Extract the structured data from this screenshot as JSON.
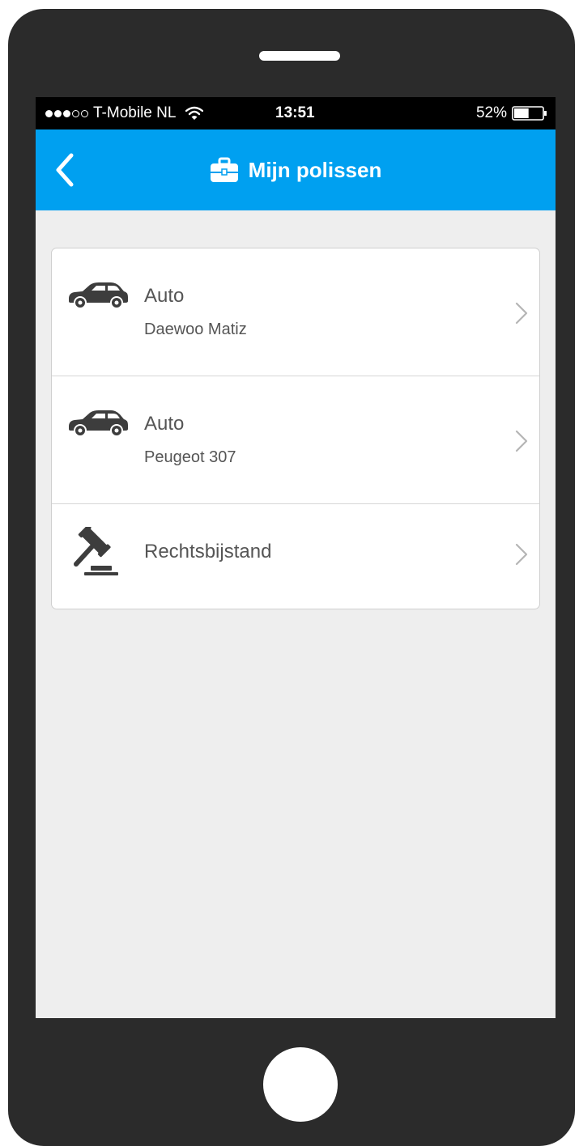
{
  "status_bar": {
    "signal_dots_filled": 3,
    "signal_dots_total": 5,
    "carrier": "T-Mobile NL",
    "time": "13:51",
    "battery_percent": "52%",
    "battery_level": 0.52
  },
  "header": {
    "back_icon": "chevron-left-icon",
    "title_icon": "briefcase-icon",
    "title": "Mijn polissen"
  },
  "policies": [
    {
      "icon": "car-icon",
      "label": "Auto",
      "sublabel": "Daewoo Matiz"
    },
    {
      "icon": "car-icon",
      "label": "Auto",
      "sublabel": "Peugeot 307"
    },
    {
      "icon": "gavel-icon",
      "label": "Rechtsbijstand",
      "sublabel": ""
    }
  ],
  "colors": {
    "accent": "#00a0f0",
    "device_frame": "#2b2b2b",
    "screen_background": "#eeeeee",
    "text": "#555555"
  }
}
